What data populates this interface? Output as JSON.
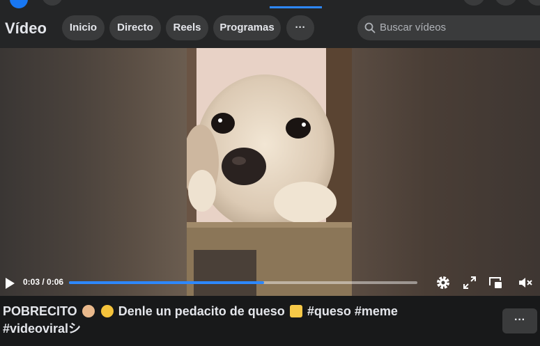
{
  "header": {
    "title": "Vídeo",
    "nav": [
      "Inicio",
      "Directo",
      "Reels",
      "Programas"
    ],
    "more_label": "···",
    "search_placeholder": "Buscar vídeos"
  },
  "player": {
    "time": "0:03 / 0:06",
    "progress": 0.56,
    "controls": [
      "play-icon",
      "settings-icon",
      "fullscreen-icon",
      "picture-in-picture-icon",
      "volume-icon"
    ]
  },
  "post": {
    "caption_part1": "POBRECITO",
    "caption_part2": "Denle un pedacito de queso",
    "caption_part3": "#queso #meme",
    "caption_part4": "#videoviralシ",
    "emojis": [
      "puppy-face-emoji",
      "crying-face-emoji",
      "cheese-emoji"
    ],
    "more_label": "···"
  },
  "colors": {
    "accent": "#2d88ff",
    "bg": "#18191a",
    "surface": "#242526",
    "pill": "#3a3b3c"
  }
}
